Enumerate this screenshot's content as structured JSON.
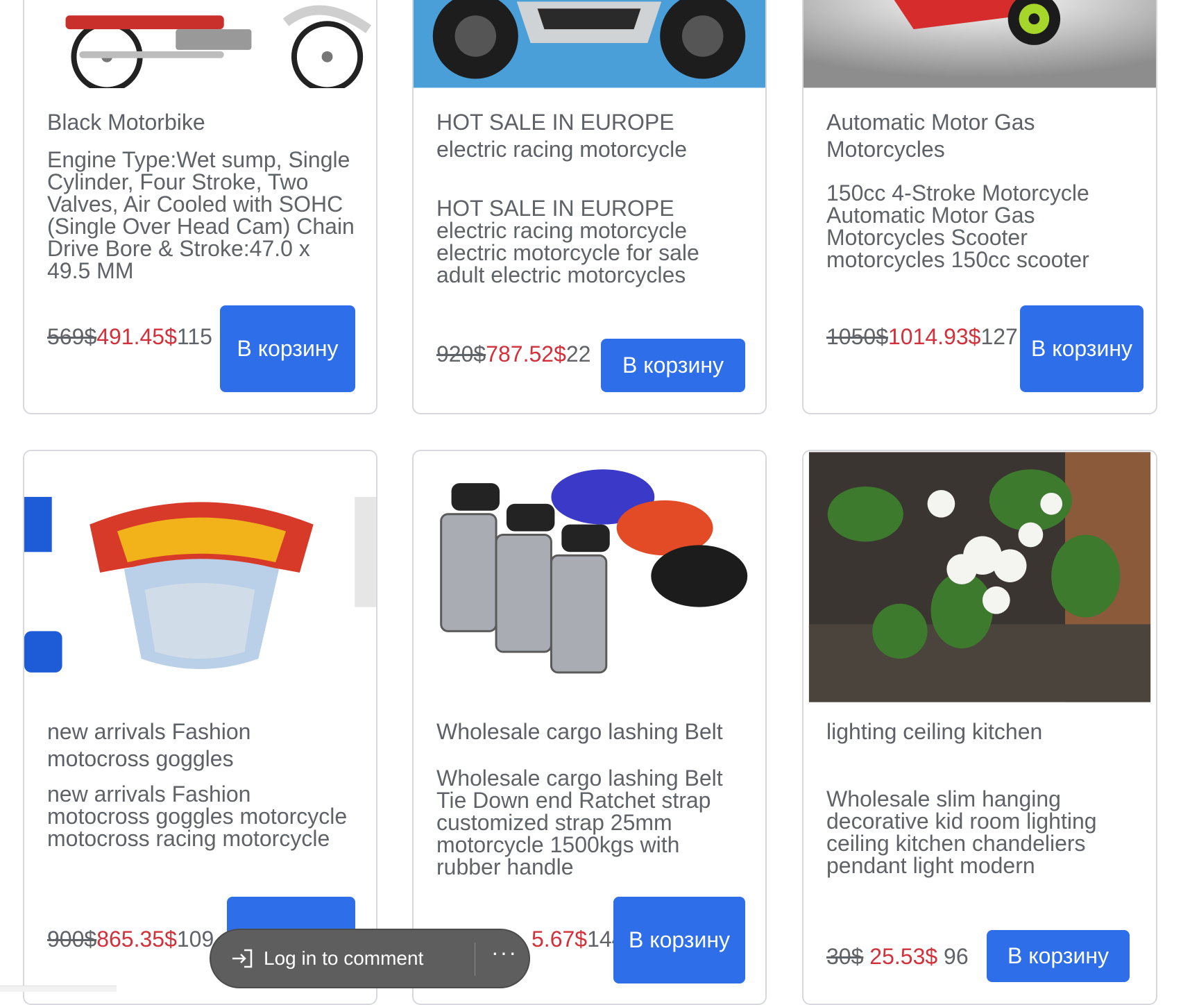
{
  "products": [
    {
      "title": "Black Motorbike",
      "description": "Engine Type:Wet sump, Single Cylinder, Four Stroke, Two Valves, Air Cooled with SOHC (Single Over Head Cam) Chain Drive Bore & Stroke:47.0 x 49.5 MM",
      "old_price": "569$",
      "new_price": "491.45$",
      "qty": "115",
      "button": "В корзину"
    },
    {
      "title": "HOT SALE IN EUROPE electric racing motorcycle",
      "description": "HOT SALE IN EUROPE electric racing motorcycle electric motorcycle for sale adult electric motorcycles",
      "old_price": "920$",
      "new_price": "787.52$",
      "qty": "22",
      "button": "В корзину"
    },
    {
      "title": "Automatic Motor Gas Motorcycles",
      "description": "150cc 4-Stroke Motorcycle Automatic Motor Gas Motorcycles Scooter motorcycles 150cc scooter",
      "old_price": "1050$",
      "new_price": "1014.93$",
      "qty": "127",
      "button": "В корзину"
    },
    {
      "title": "new arrivals Fashion motocross goggles",
      "description": "new arrivals Fashion motocross goggles motorcycle motocross racing motorcycle",
      "old_price": "900$",
      "new_price": "865.35$",
      "qty": "109",
      "button": "В корзину"
    },
    {
      "title": "Wholesale cargo lashing Belt",
      "description": "Wholesale cargo lashing Belt Tie Down end Ratchet strap customized strap 25mm motorcycle 1500kgs with rubber handle",
      "old_price": "",
      "new_price": "5.67$",
      "qty": "144",
      "button": "В корзину"
    },
    {
      "title": "lighting ceiling kitchen",
      "description": "Wholesale slim hanging decorative kid room lighting ceiling kitchen chandeliers pendant light modern",
      "old_price": "30$",
      "new_price": "25.53$",
      "qty": "96",
      "button": "В корзину"
    }
  ],
  "comment_bar": {
    "login_label": "Log in to comment",
    "more_label": "···"
  },
  "colors": {
    "accent": "#2e6ee8",
    "sale_price": "#d2313b",
    "text": "#5f6368"
  }
}
